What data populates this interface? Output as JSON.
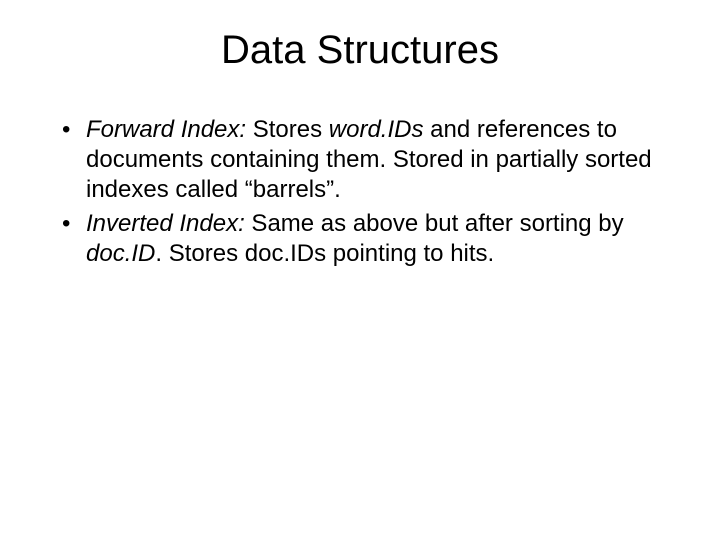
{
  "title": "Data Structures",
  "bullets": [
    {
      "term": "Forward Index:",
      "part1": " Stores ",
      "italic1": "word.IDs",
      "part2": " and references to documents containing them. Stored in partially sorted indexes called “barrels”."
    },
    {
      "term": "Inverted Index:",
      "part1": " Same as above but after sorting by ",
      "italic1": "doc.ID",
      "part2": ". Stores doc.IDs pointing to hits."
    }
  ]
}
